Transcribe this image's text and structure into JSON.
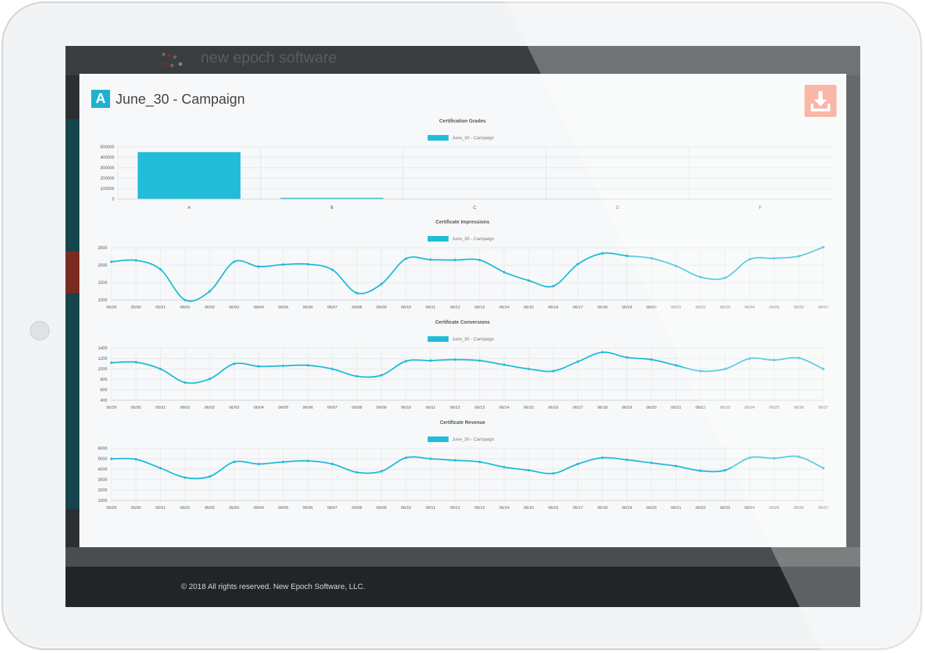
{
  "app": {
    "logo_text": "new epoch software"
  },
  "modal": {
    "badge": "A",
    "title": "June_30 - Campaign",
    "download_icon": "download-icon"
  },
  "footer": {
    "text": "© 2018 All rights reserved. New Epoch Software, LLC."
  },
  "colors": {
    "accent": "#1fb1cf",
    "download_button": "#f69b86",
    "line": "#21bcd8"
  },
  "chart_data": [
    {
      "type": "bar",
      "title": "Certification Grades",
      "legend": "June_30 - Campaign",
      "categories": [
        "A",
        "B",
        "C",
        "D",
        "F"
      ],
      "values": [
        450000,
        12000,
        0,
        0,
        0
      ],
      "yticks": [
        "0",
        "100000",
        "200000",
        "300000",
        "400000",
        "500000"
      ],
      "ylim": [
        0,
        500000
      ]
    },
    {
      "type": "line",
      "title": "Certificate Impressions",
      "legend": "June_30 - Campaign",
      "x": [
        "05/29",
        "05/30",
        "05/31",
        "06/01",
        "06/02",
        "06/03",
        "06/04",
        "06/05",
        "06/06",
        "06/07",
        "06/08",
        "06/09",
        "06/10",
        "06/11",
        "06/12",
        "06/13",
        "06/14",
        "06/15",
        "06/16",
        "06/17",
        "06/18",
        "06/19",
        "06/20",
        "06/21",
        "06/22",
        "06/23",
        "06/24",
        "06/25",
        "06/26",
        "06/27"
      ],
      "values": [
        2100,
        2140,
        1880,
        1000,
        1250,
        2100,
        1960,
        2020,
        2030,
        1870,
        1200,
        1460,
        2190,
        2160,
        2150,
        2150,
        1800,
        1560,
        1400,
        2030,
        2340,
        2270,
        2200,
        1980,
        1660,
        1640,
        2170,
        2200,
        2260,
        2520
      ],
      "yticks": [
        "1000",
        "1500",
        "2000",
        "2500"
      ],
      "ylim": [
        1000,
        2500
      ]
    },
    {
      "type": "line",
      "title": "Certificate Conversions",
      "legend": "June_30 - Campaign",
      "x": [
        "05/29",
        "05/30",
        "05/31",
        "06/01",
        "06/02",
        "06/03",
        "06/04",
        "06/05",
        "06/06",
        "06/07",
        "06/08",
        "06/09",
        "06/10",
        "06/11",
        "06/12",
        "06/13",
        "06/14",
        "06/15",
        "06/16",
        "06/17",
        "06/18",
        "06/19",
        "06/20",
        "06/21",
        "06/22",
        "06/23",
        "06/24",
        "06/25",
        "06/26",
        "06/27"
      ],
      "values": [
        1120,
        1130,
        1000,
        740,
        810,
        1100,
        1050,
        1060,
        1070,
        1000,
        860,
        880,
        1150,
        1160,
        1180,
        1160,
        1080,
        1000,
        960,
        1140,
        1320,
        1220,
        1180,
        1070,
        960,
        1000,
        1200,
        1170,
        1210,
        1000
      ],
      "yticks": [
        "400",
        "600",
        "800",
        "1000",
        "1200",
        "1400"
      ],
      "ylim": [
        400,
        1400
      ]
    },
    {
      "type": "line",
      "title": "Certificate Revenue",
      "legend": "June_30 - Campaign",
      "x": [
        "05/29",
        "05/30",
        "05/31",
        "06/01",
        "06/02",
        "06/03",
        "06/04",
        "06/05",
        "06/06",
        "06/07",
        "06/08",
        "06/09",
        "06/10",
        "06/11",
        "06/12",
        "06/13",
        "06/14",
        "06/15",
        "06/16",
        "06/17",
        "06/18",
        "06/19",
        "06/20",
        "06/21",
        "06/22",
        "06/23",
        "06/24",
        "06/25",
        "06/26",
        "06/27"
      ],
      "values": [
        5000,
        4950,
        4100,
        3200,
        3300,
        4700,
        4500,
        4700,
        4800,
        4500,
        3700,
        3800,
        5100,
        5000,
        4850,
        4700,
        4200,
        3900,
        3600,
        4500,
        5100,
        4900,
        4600,
        4300,
        3850,
        3900,
        5100,
        5050,
        5200,
        4100
      ],
      "yticks": [
        "1000",
        "2000",
        "3000",
        "4000",
        "5000",
        "6000"
      ],
      "ylim": [
        1000,
        6000
      ]
    }
  ]
}
